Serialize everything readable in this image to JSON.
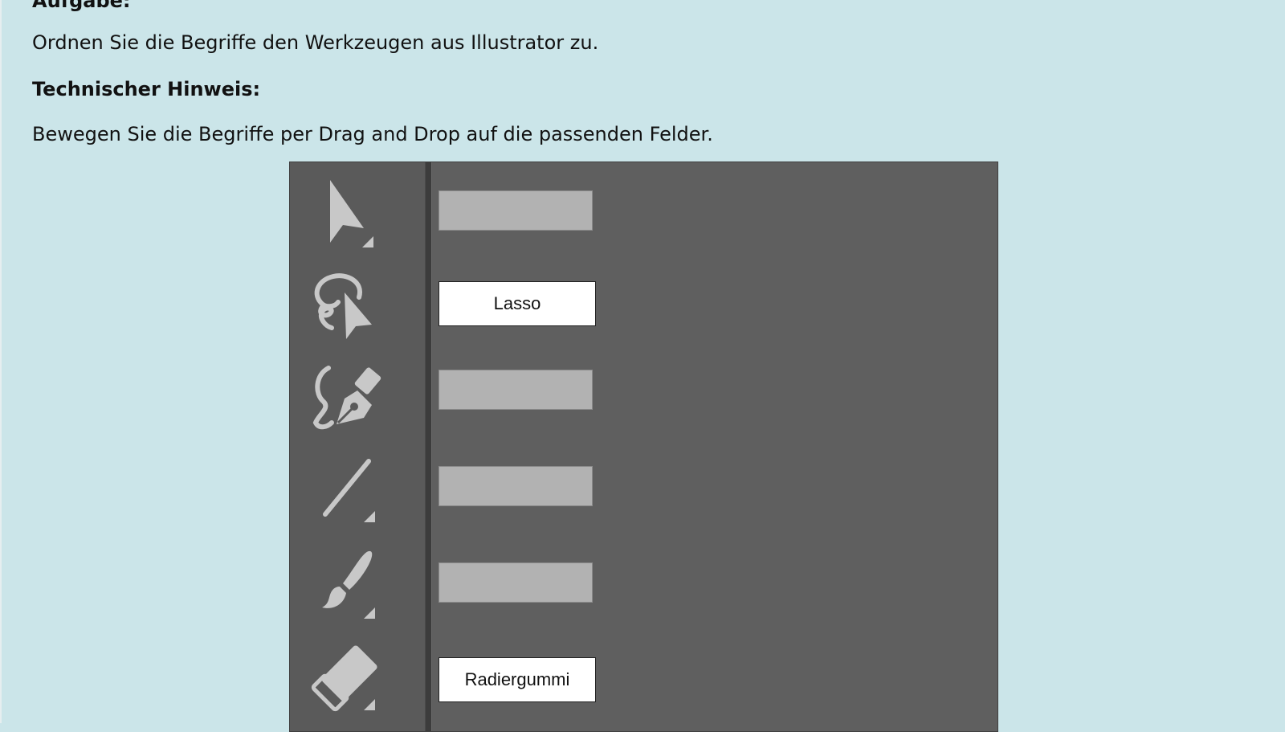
{
  "task": {
    "heading": "Aufgabe:",
    "instruction": "Ordnen Sie die Begriffe den Werkzeugen aus Illustrator zu."
  },
  "hint": {
    "heading": "Technischer Hinweis:",
    "text": "Bewegen Sie die Begriffe per Drag and Drop auf die passenden Felder."
  },
  "exercise": {
    "tools": [
      {
        "icon": "selection-arrow-icon",
        "slot_filled": false,
        "term": ""
      },
      {
        "icon": "lasso-icon",
        "slot_filled": true,
        "term": "Lasso"
      },
      {
        "icon": "pen-tool-icon",
        "slot_filled": false,
        "term": ""
      },
      {
        "icon": "line-segment-icon",
        "slot_filled": false,
        "term": ""
      },
      {
        "icon": "paintbrush-icon",
        "slot_filled": false,
        "term": ""
      },
      {
        "icon": "eraser-icon",
        "slot_filled": true,
        "term": "Radiergummi"
      }
    ],
    "colors": {
      "page_background": "#cbe5e9",
      "panel_background": "#5f5f5f",
      "icon_color": "#c8c8c8",
      "empty_slot": "#b2b2b2",
      "term_background": "#ffffff"
    }
  }
}
